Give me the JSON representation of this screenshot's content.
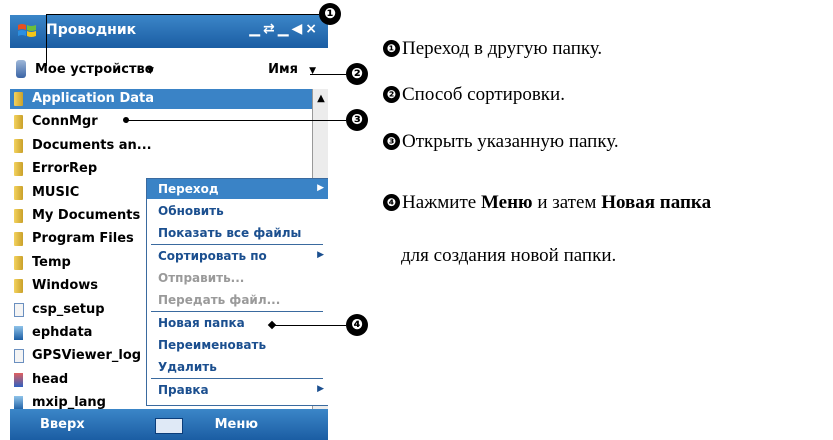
{
  "title_bar": {
    "app_title": "Проводник",
    "status_icons": "▁⇄▁◀×"
  },
  "path_bar": {
    "location": "Мое устройство",
    "sort_label": "Имя"
  },
  "file_list": [
    {
      "name": "Application Data",
      "icon": "folder-icon",
      "selected": true
    },
    {
      "name": "ConnMgr",
      "icon": "folder-icon"
    },
    {
      "name": "Documents an...",
      "icon": "folder-icon"
    },
    {
      "name": "ErrorRep",
      "icon": "folder-icon"
    },
    {
      "name": "MUSIC",
      "icon": "folder-icon"
    },
    {
      "name": "My Documents",
      "icon": "folder-icon"
    },
    {
      "name": "Program Files",
      "icon": "folder-icon"
    },
    {
      "name": "Temp",
      "icon": "folder-icon"
    },
    {
      "name": "Windows",
      "icon": "folder-icon"
    },
    {
      "name": "csp_setup",
      "icon": "file-icon"
    },
    {
      "name": "ephdata",
      "icon": "app-icon"
    },
    {
      "name": "GPSViewer_log",
      "icon": "file-icon"
    },
    {
      "name": "head",
      "icon": "image-icon"
    },
    {
      "name": "mxip_lang",
      "icon": "app-icon"
    }
  ],
  "menu": [
    {
      "label": "Переход",
      "submenu": true,
      "selected": true
    },
    {
      "label": "Обновить"
    },
    {
      "label": "Показать все файлы"
    },
    {
      "label": "Сортировать по",
      "submenu": true
    },
    {
      "label": "Отправить...",
      "disabled": true
    },
    {
      "label": "Передать файл...",
      "disabled": true
    },
    {
      "label": "Новая папка"
    },
    {
      "label": "Переименовать"
    },
    {
      "label": "Удалить"
    },
    {
      "label": "Правка",
      "submenu": true
    }
  ],
  "softkeys": {
    "left": "Вверх",
    "right": "Меню"
  },
  "callouts": [
    "❶",
    "❷",
    "❸",
    "❹"
  ],
  "notes": {
    "n1": {
      "num": "❶",
      "text": "Переход в другую папку."
    },
    "n2": {
      "num": "❷",
      "text": "Способ сортировки."
    },
    "n3": {
      "num": "❸",
      "text": "Открыть указанную папку."
    },
    "n4": {
      "num": "❹",
      "pre": "Нажмите ",
      "b1": "Меню",
      "mid": " и затем ",
      "b2": "Новая папка"
    },
    "n5": {
      "text": "для создания новой папки."
    }
  }
}
